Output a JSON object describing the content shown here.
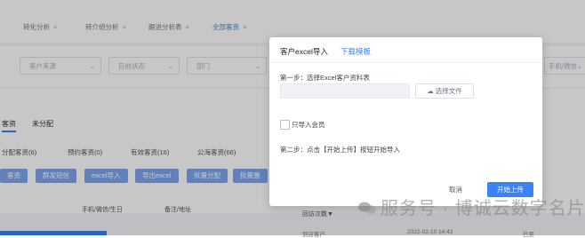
{
  "tabs": [
    {
      "label": "转化分析",
      "active": false
    },
    {
      "label": "转介绍分析",
      "active": false
    },
    {
      "label": "跟进分析表",
      "active": false
    },
    {
      "label": "全部客资",
      "active": true
    }
  ],
  "filters": [
    "客户来源",
    "目前状态",
    "部门",
    "手机/微信"
  ],
  "subtabs": [
    "客资",
    "未分配"
  ],
  "counts": [
    "分配客资(6)",
    "预约客资(0)",
    "有效客资(16)",
    "公海客资(66)"
  ],
  "actions": [
    "客资",
    "群发短信",
    "excel导入",
    "导出excel",
    "批量分配",
    "批量删"
  ],
  "table_headers": [
    "手机/微信/生日",
    "备注/地址",
    "回访次数▼"
  ],
  "table_row": [
    "到店客户",
    "2022-02-10 14:43",
    "已至"
  ],
  "modal": {
    "title": "客户excel导入",
    "template_link": "下载模板",
    "step1": "第一步：选择Excel客户资料表",
    "choose_file": "选择文件",
    "import_member": "只导入会员",
    "step2": "第二步：点击【开始上传】按钮开始导入",
    "cancel": "取消",
    "start": "开始上传"
  },
  "watermark": "服务号 · 博诚云数字名片",
  "colors": {
    "accent": "#3b82f6",
    "button_faded": "#7ea6f0"
  }
}
